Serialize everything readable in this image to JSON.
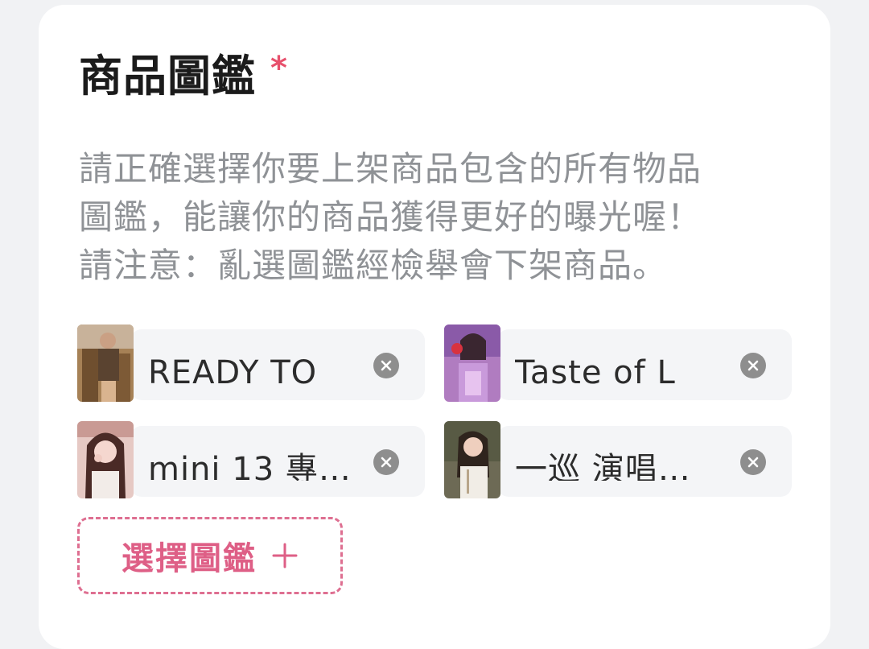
{
  "section": {
    "title": "商品圖鑑",
    "required_mark": "*",
    "description_lines": [
      "請正確選擇你要上架商品包含的所有物品",
      "圖鑑，能讓你的商品獲得更好的曝光喔！",
      "請注意：亂選圖鑑經檢舉會下架商品。"
    ]
  },
  "selected_items": [
    {
      "label": "READY TO",
      "thumbnail": "photo-thumbnail"
    },
    {
      "label": "Taste of L",
      "thumbnail": "photo-thumbnail"
    },
    {
      "label": "mini 13 專…",
      "thumbnail": "photo-thumbnail"
    },
    {
      "label": "一巡 演唱…",
      "thumbnail": "photo-thumbnail"
    }
  ],
  "add_button": {
    "label": "選擇圖鑑",
    "icon": "plus-icon"
  },
  "colors": {
    "accent": "#de5f86",
    "required": "#e7506c",
    "chip_background": "#f4f5f7",
    "remove_icon": "#8e8e8e"
  }
}
